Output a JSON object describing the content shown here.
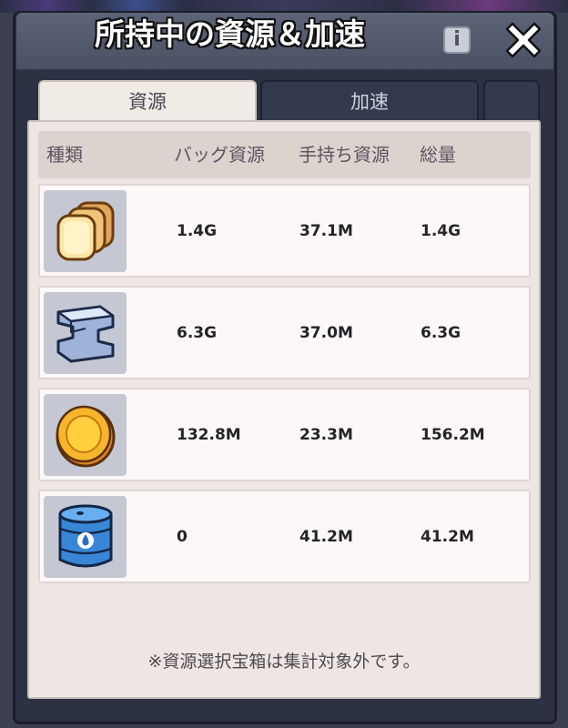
{
  "window": {
    "title": "所持中の資源＆加速",
    "info_label": "i"
  },
  "tabs": [
    {
      "label": "資源",
      "active": true
    },
    {
      "label": "加速",
      "active": false
    }
  ],
  "table": {
    "headers": [
      "種類",
      "バッグ資源",
      "手持ち資源",
      "総量"
    ],
    "rows": [
      {
        "icon": "bread-icon",
        "bag": "1.4G",
        "hand": "37.1M",
        "total": "1.4G"
      },
      {
        "icon": "iron-ingot-icon",
        "bag": "6.3G",
        "hand": "37.0M",
        "total": "6.3G"
      },
      {
        "icon": "gold-coin-icon",
        "bag": "132.8M",
        "hand": "23.3M",
        "total": "156.2M"
      },
      {
        "icon": "oil-barrel-icon",
        "bag": "0",
        "hand": "41.2M",
        "total": "41.2M"
      }
    ]
  },
  "footer_note": "※資源選択宝箱は集計対象外です。",
  "colors": {
    "panel": "#2c3144",
    "title_bar": "#5d6478",
    "content_bg": "#ede6e2",
    "row_bg": "#fcf8f7",
    "icon_tile": "#c5c8d3"
  }
}
